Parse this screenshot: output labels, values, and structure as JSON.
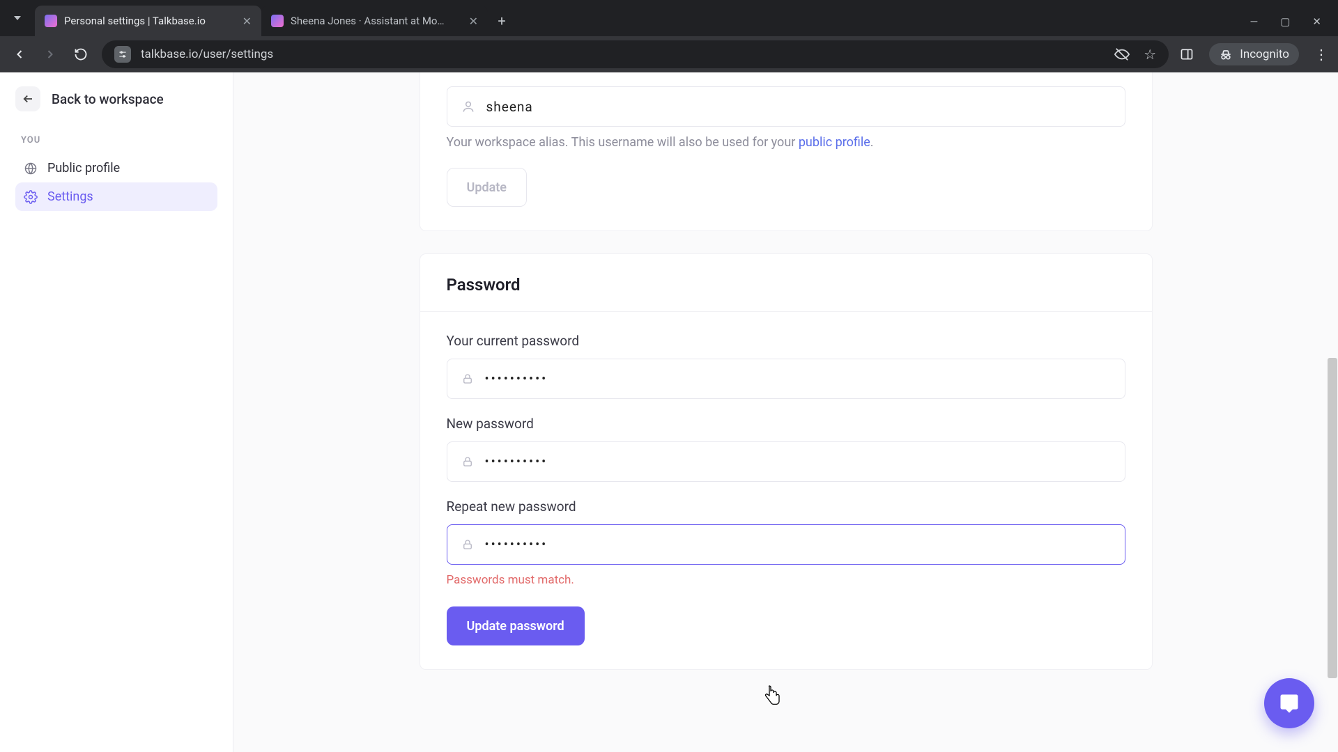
{
  "browser": {
    "tabs": [
      {
        "title": "Personal settings | Talkbase.io",
        "active": true
      },
      {
        "title": "Sheena Jones · Assistant at Mo…",
        "active": false
      }
    ],
    "url": "talkbase.io/user/settings",
    "incognito_label": "Incognito"
  },
  "sidebar": {
    "back_label": "Back to workspace",
    "group_label": "YOU",
    "items": [
      {
        "label": "Public profile",
        "active": false
      },
      {
        "label": "Settings",
        "active": true
      }
    ]
  },
  "username_section": {
    "value": "sheena",
    "helper_pre": "Your workspace alias. This username will also be used for your ",
    "helper_link": "public profile",
    "helper_post": ".",
    "update_label": "Update"
  },
  "password_section": {
    "title": "Password",
    "current_label": "Your current password",
    "current_value": "••••••••••",
    "new_label": "New password",
    "new_value": "••••••••••",
    "repeat_label": "Repeat new password",
    "repeat_value": "••••••••••",
    "error": "Passwords must match.",
    "submit_label": "Update password"
  }
}
